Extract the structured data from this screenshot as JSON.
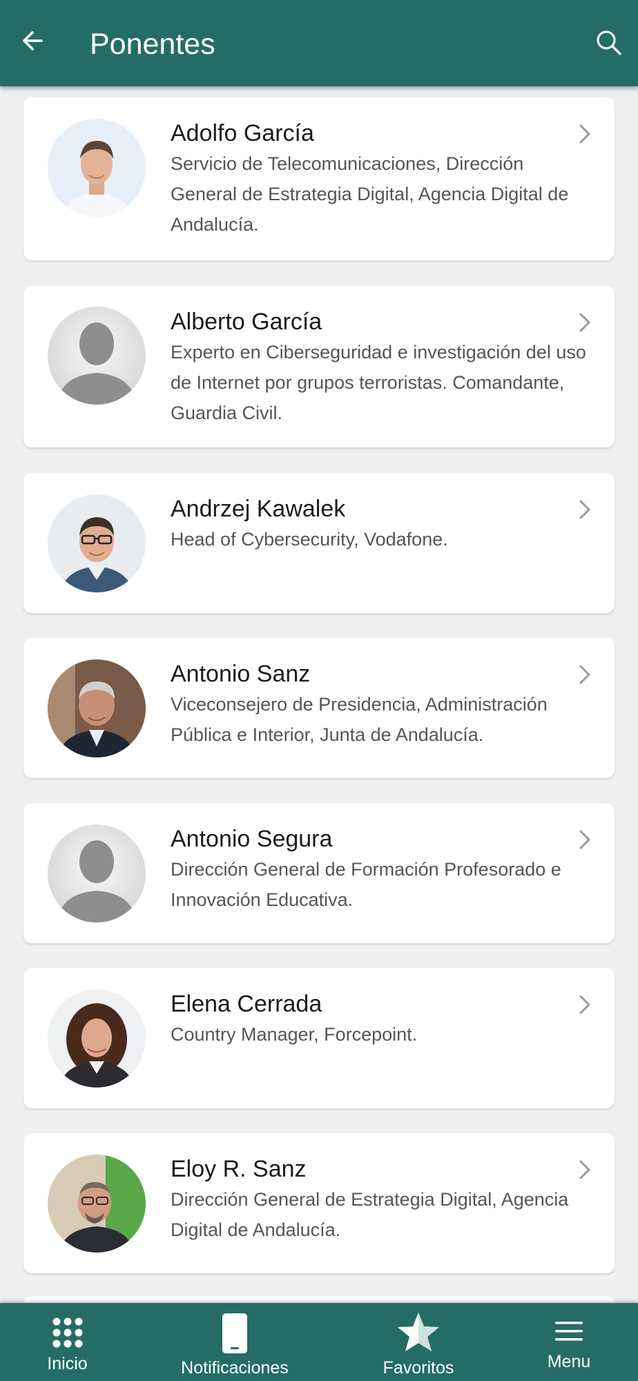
{
  "header": {
    "title": "Ponentes",
    "back_icon": "arrow-left-icon",
    "search_icon": "search-icon"
  },
  "colors": {
    "primary": "#256c67",
    "background": "#efefef",
    "card": "#ffffff",
    "name_text": "#1b1b1b",
    "desc_text": "#555555"
  },
  "speakers": [
    {
      "name": "Adolfo García",
      "description": "Servicio de Telecomunicaciones, Dirección General de Estrategia Digital, Agencia Digital de Andalucía."
    },
    {
      "name": "Alberto García",
      "description": "Experto en Ciberseguridad e investigación del uso de Internet por grupos terroristas. Comandante, Guardia Civil."
    },
    {
      "name": "Andrzej Kawalek",
      "description": "Head of Cybersecurity, Vodafone."
    },
    {
      "name": "Antonio Sanz",
      "description": "Viceconsejero de Presidencia, Administración Pública e Interior, Junta de Andalucía."
    },
    {
      "name": "Antonio Segura",
      "description": "Dirección General de Formación Profesorado e Innovación Educativa."
    },
    {
      "name": "Elena Cerrada",
      "description": "Country Manager, Forcepoint."
    },
    {
      "name": "Eloy R. Sanz",
      "description": "Dirección General de Estrategia Digital, Agencia Digital de Andalucía."
    }
  ],
  "bottom_nav": {
    "items": [
      {
        "label": "Inicio",
        "icon": "grid-icon"
      },
      {
        "label": "Notificaciones",
        "icon": "phone-icon"
      },
      {
        "label": "Favoritos",
        "icon": "star-icon"
      },
      {
        "label": "Menu",
        "icon": "menu-icon"
      }
    ]
  }
}
